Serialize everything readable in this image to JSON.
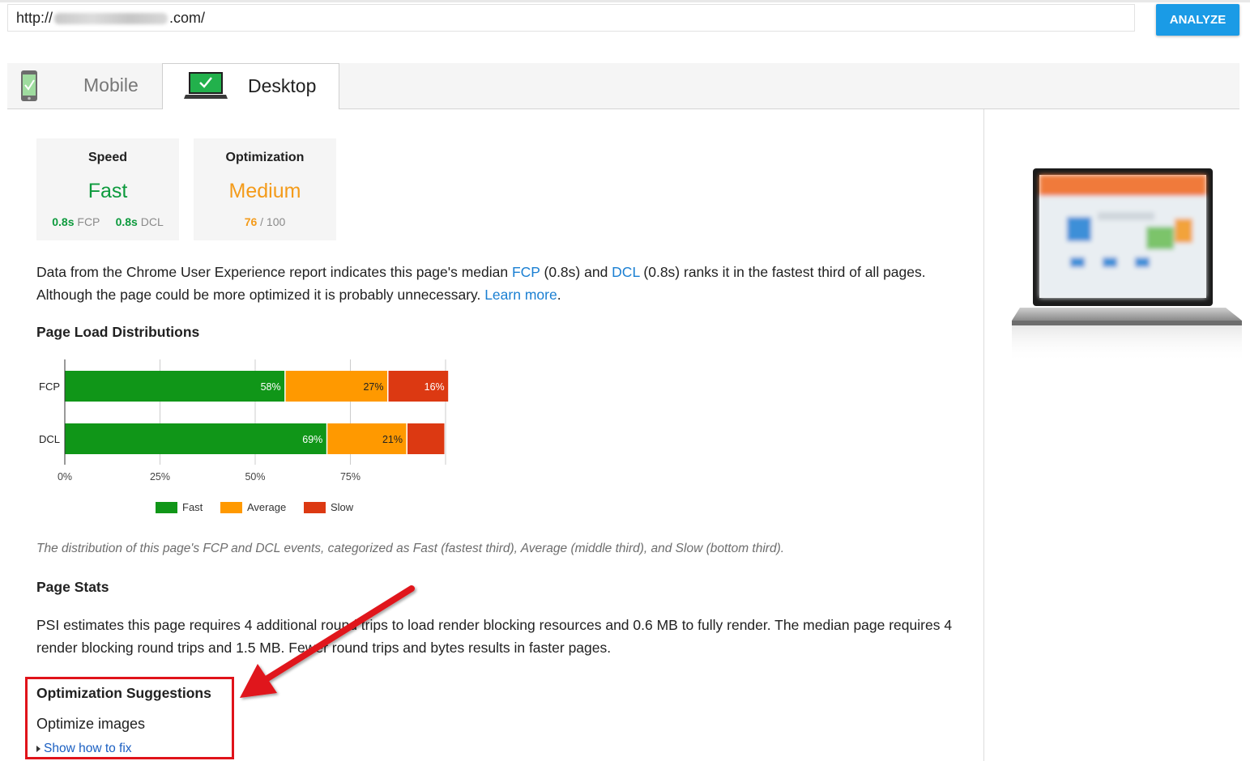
{
  "search": {
    "url_prefix": "http://",
    "url_blurred": "www.wpbeginner",
    "url_suffix": ".com/",
    "analyze_label": "ANALYZE"
  },
  "tabs": [
    {
      "label": "Mobile",
      "active": false
    },
    {
      "label": "Desktop",
      "active": true
    }
  ],
  "speed": {
    "title": "Speed",
    "rating": "Fast",
    "fcp_value": "0.8s",
    "fcp_label": "FCP",
    "dcl_value": "0.8s",
    "dcl_label": "DCL"
  },
  "optimization": {
    "title": "Optimization",
    "rating": "Medium",
    "score": "76",
    "score_max": "/ 100"
  },
  "summary": {
    "text_1": "Data from the Chrome User Experience report indicates this page's median ",
    "fcp_link": "FCP",
    "text_2": " (0.8s) and ",
    "dcl_link": "DCL",
    "text_3": " (0.8s) ranks it in the fastest third of all pages.",
    "text_4": "Although the page could be more optimized it is probably unnecessary. ",
    "learn_more": "Learn more",
    "text_5": "."
  },
  "distribution": {
    "heading": "Page Load Distributions",
    "caption": "The distribution of this page's FCP and DCL events, categorized as Fast (fastest third), Average (middle third), and Slow (bottom third)."
  },
  "chart_data": {
    "type": "bar",
    "orientation": "horizontal",
    "stacked": true,
    "categories": [
      "FCP",
      "DCL"
    ],
    "series": [
      {
        "name": "Fast",
        "color": "#109618",
        "values": [
          58,
          69
        ],
        "labels": [
          "58%",
          "69%"
        ]
      },
      {
        "name": "Average",
        "color": "#ff9900",
        "values": [
          27,
          21
        ],
        "labels": [
          "27%",
          "21%"
        ]
      },
      {
        "name": "Slow",
        "color": "#dc3912",
        "values": [
          16,
          10
        ],
        "labels": [
          "16%",
          ""
        ]
      }
    ],
    "x_ticks": [
      "0%",
      "25%",
      "50%",
      "75%"
    ],
    "xlim": [
      0,
      100
    ],
    "legend_position": "bottom",
    "grid": true
  },
  "stats": {
    "heading": "Page Stats",
    "text": "PSI estimates this page requires 4 additional round trips to load render blocking resources and 0.6 MB to fully render. The median page requires 4 render blocking round trips and 1.5 MB. Fewer round trips and bytes results in faster pages."
  },
  "suggestions": {
    "heading": "Optimization Suggestions",
    "item": "Optimize images",
    "show_fix": "Show how to fix"
  },
  "colors": {
    "accent": "#1a9be6",
    "fast": "#0d9a3d",
    "medium": "#f49b1a",
    "link": "#1a7fd2",
    "annotation": "#e0131a"
  },
  "icons": {
    "mobile_tab": "phone-check-icon",
    "desktop_tab": "laptop-check-icon",
    "show_fix": "triangle-right-icon"
  }
}
